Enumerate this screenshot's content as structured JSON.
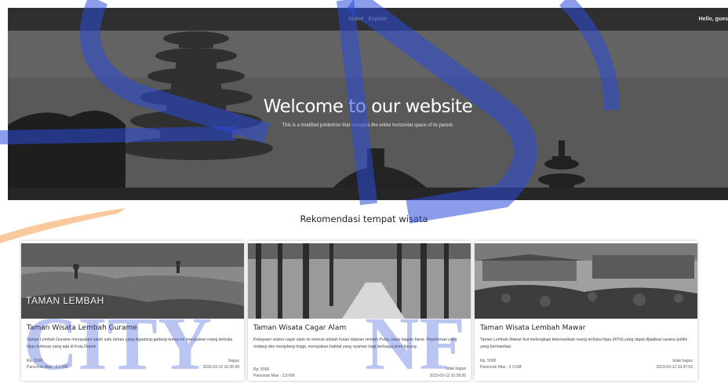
{
  "nav": {
    "links": [
      "Home",
      "Explore"
    ],
    "greeting": "Hello, gues"
  },
  "hero": {
    "title": "Welcome to our website",
    "subtitle": "This is a modified jumbotron that occupies the entire horizontal space of its parent."
  },
  "section": {
    "heading": "Rekomendasi tempat wisata"
  },
  "cards": [
    {
      "title": "Taman Wisata Lembah Gurame",
      "image_text": "TAMAN LEMBAH",
      "description": "Taman Lembah Gurame merupakan salah satu taman yang digadang-gadang taman ini merupakan ruang terbuka hijau terbesar yang ada di Kota Depok.",
      "price": "Rp. 5000",
      "location": "Pancoran Mas - 2,1 KM",
      "status": "bagus",
      "date": "2023-03-12 16:26:49"
    },
    {
      "title": "Taman Wisata Cagar Alam",
      "description": "Kekayaan utama cagar alam ini semula adalah hutan dataran rendah Pulau Jawa bagian barat. Pepohonan yang rindang dan menjulang tinggi, merupakan habitat yang nyaman bagi berbagai jenis burung.",
      "price": "Rp. 5000",
      "location": "Pancoran Mas - 3,5 KM",
      "status": "tidak bagus",
      "date": "2023-03-12 16:39:35"
    },
    {
      "title": "Taman Wisata Lembah Mawar",
      "description": "Taman Lembah Mawar ikut melengkapi ketersediaan ruang terbuka hijau (RTH) yang dapat dijadikan sarana publik yang bermanfaat.",
      "price": "Rp. 5000",
      "location": "Pancoran Mas - 2,3 KM",
      "status": "tidak bagus",
      "date": "2023-03-12 16:47:53"
    }
  ],
  "colors": {
    "navbar": "#2f2f2f",
    "watermark_blue": "#2b4bd8",
    "watermark_orange": "#f5a45a"
  }
}
